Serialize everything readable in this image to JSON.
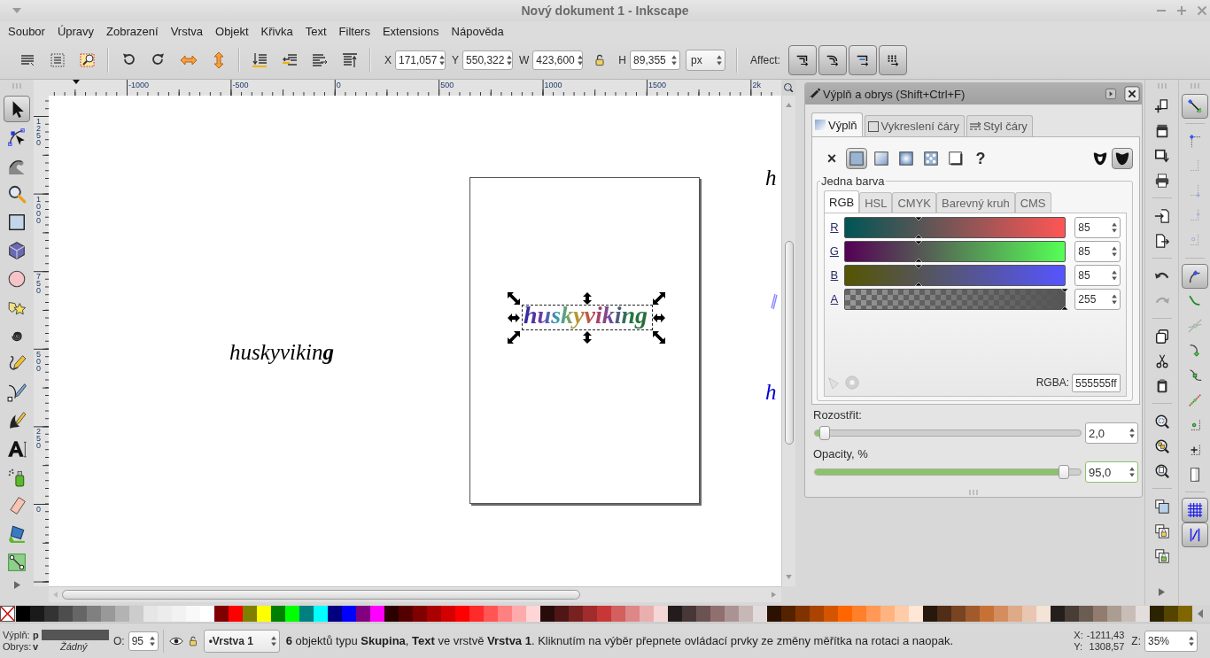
{
  "window": {
    "title": "Nový dokument 1 - Inkscape"
  },
  "menu": [
    "Soubor",
    "Úpravy",
    "Zobrazení",
    "Vrstva",
    "Objekt",
    "Křivka",
    "Text",
    "Filters",
    "Extensions",
    "Nápověda"
  ],
  "toolbar": {
    "fields": [
      {
        "label": "X",
        "value": "171,057"
      },
      {
        "label": "Y",
        "value": "550,322"
      },
      {
        "label": "W",
        "value": "423,600"
      },
      {
        "label": "H",
        "value": "89,355"
      }
    ],
    "unit": "px",
    "affect_label": "Affect:",
    "affect": [
      {
        "selected": true
      },
      {
        "selected": true
      },
      {
        "selected": true
      },
      {
        "selected": true
      }
    ]
  },
  "rulers": {
    "horizontal": [
      "-1000",
      "-500",
      "0",
      "500",
      "1000",
      "1500",
      "2k"
    ],
    "vertical": [
      "1250",
      "1000",
      "750",
      "500",
      "250",
      "0"
    ]
  },
  "tools": [
    {
      "selected": true
    },
    {
      "selected": false
    },
    {
      "selected": false
    },
    {
      "selected": false
    },
    {
      "selected": false
    },
    {
      "selected": false
    },
    {
      "selected": false
    },
    {
      "selected": false
    },
    {
      "selected": false
    },
    {
      "selected": false
    },
    {
      "selected": false
    },
    {
      "selected": false
    },
    {
      "selected": false
    },
    {
      "selected": false
    },
    {
      "selected": false
    },
    {
      "selected": false
    },
    {
      "selected": false
    }
  ],
  "canvas": {
    "loose_text": "huskyvikin**g**",
    "selected_text": "huskyviking",
    "edge_texts": [
      {
        "text": "h",
        "color": "#000000"
      },
      {
        "text": "h",
        "color": "#0000cc"
      }
    ]
  },
  "fill_stroke": {
    "title": "Výplň a obrys (Shift+Ctrl+F)",
    "tabs": [
      {
        "label": "Výplň",
        "selected": true
      },
      {
        "label": "Vykreslení čáry",
        "selected": false
      },
      {
        "label": "Styl čáry",
        "selected": false
      }
    ],
    "paint_types": [
      {
        "kind": "none",
        "label": "×",
        "selected": false
      },
      {
        "kind": "flat",
        "selected": true
      },
      {
        "kind": "linear",
        "selected": false
      },
      {
        "kind": "radial",
        "selected": false
      },
      {
        "kind": "pattern",
        "selected": false
      },
      {
        "kind": "swatch",
        "selected": false
      },
      {
        "kind": "unset",
        "label": "?",
        "selected": false
      }
    ],
    "fill_rules": [
      {
        "kind": "evenodd",
        "selected": false
      },
      {
        "kind": "nonzero",
        "selected": true
      }
    ],
    "mode_label": "Jedna barva",
    "color_tabs": [
      {
        "label": "RGB",
        "selected": true
      },
      {
        "label": "HSL",
        "selected": false
      },
      {
        "label": "CMYK",
        "selected": false
      },
      {
        "label": "Barevný kruh",
        "selected": false
      },
      {
        "label": "CMS",
        "selected": false
      }
    ],
    "channels": [
      {
        "name": "R",
        "value": "85",
        "level": 0.333
      },
      {
        "name": "G",
        "value": "85",
        "level": 0.333
      },
      {
        "name": "B",
        "value": "85",
        "level": 0.333
      },
      {
        "name": "A",
        "value": "255",
        "level": 1
      }
    ],
    "rgba_label": "RGBA:",
    "rgba": "555555ff",
    "blur": {
      "label": "Rozostřit:",
      "value": "2,0",
      "level": 0.02
    },
    "opacity": {
      "label": "Opacity, %",
      "value": "95,0",
      "level": 0.95
    }
  },
  "commands": [
    {
      "disabled": false
    },
    {
      "disabled": false
    },
    {
      "disabled": false
    },
    {
      "disabled": false
    },
    {
      "disabled": false
    },
    {
      "disabled": false
    },
    {
      "disabled": false
    },
    {
      "disabled": true
    },
    {
      "disabled": false
    },
    {
      "disabled": false
    },
    {
      "disabled": false
    },
    {
      "disabled": false
    },
    {
      "disabled": false
    },
    {
      "disabled": false
    },
    {
      "disabled": false
    },
    {
      "disabled": false
    },
    {
      "disabled": false
    }
  ],
  "snap": [
    {
      "selected": true,
      "disabled": false
    },
    {
      "selected": false,
      "disabled": false
    },
    {
      "selected": false,
      "disabled": true
    },
    {
      "selected": false,
      "disabled": true
    },
    {
      "selected": false,
      "disabled": true
    },
    {
      "selected": false,
      "disabled": true
    },
    {
      "selected": true,
      "disabled": false
    },
    {
      "selected": false,
      "disabled": false
    },
    {
      "selected": false,
      "disabled": true
    },
    {
      "selected": false,
      "disabled": false
    },
    {
      "selected": false,
      "disabled": false
    },
    {
      "selected": false,
      "disabled": false
    },
    {
      "selected": false,
      "disabled": false
    },
    {
      "selected": false,
      "disabled": false
    },
    {
      "selected": false,
      "disabled": false
    },
    {
      "selected": true,
      "disabled": false
    },
    {
      "selected": true,
      "disabled": false
    }
  ],
  "palette": {
    "swatches": [
      {
        "color": "#000000"
      },
      {
        "color": "#1a1a1a"
      },
      {
        "color": "#333333"
      },
      {
        "color": "#4d4d4d"
      },
      {
        "color": "#666666"
      },
      {
        "color": "#808080"
      },
      {
        "color": "#999999"
      },
      {
        "color": "#b3b3b3"
      },
      {
        "color": "#cccccc"
      },
      {
        "color": "#e6e6e6"
      },
      {
        "color": "#ececec"
      },
      {
        "color": "#f2f2f2"
      },
      {
        "color": "#f9f9f9"
      },
      {
        "color": "#ffffff"
      },
      {
        "color": "#800000"
      },
      {
        "color": "#ff0000"
      },
      {
        "color": "#808000"
      },
      {
        "color": "#ffff00"
      },
      {
        "color": "#008000"
      },
      {
        "color": "#00ff00"
      },
      {
        "color": "#008080"
      },
      {
        "color": "#00ffff"
      },
      {
        "color": "#000080"
      },
      {
        "color": "#0000ff"
      },
      {
        "color": "#800080"
      },
      {
        "color": "#ff00ff"
      },
      {
        "color": "#2b0000"
      },
      {
        "color": "#550000"
      },
      {
        "color": "#800000"
      },
      {
        "color": "#aa0000"
      },
      {
        "color": "#d40000"
      },
      {
        "color": "#ff0000"
      },
      {
        "color": "#ff2a2a"
      },
      {
        "color": "#ff5555"
      },
      {
        "color": "#ff8080"
      },
      {
        "color": "#ffaaaa"
      },
      {
        "color": "#ffd5d5"
      },
      {
        "color": "#280b0b"
      },
      {
        "color": "#501616"
      },
      {
        "color": "#782121"
      },
      {
        "color": "#a02c2c"
      },
      {
        "color": "#c83737"
      },
      {
        "color": "#d35f5f"
      },
      {
        "color": "#de8787"
      },
      {
        "color": "#e9afaf"
      },
      {
        "color": "#f4d7d7"
      },
      {
        "color": "#241c1c"
      },
      {
        "color": "#483737"
      },
      {
        "color": "#6c5353"
      },
      {
        "color": "#916f6f"
      },
      {
        "color": "#ac9393"
      },
      {
        "color": "#c8b7b7"
      },
      {
        "color": "#e3dbdb"
      },
      {
        "color": "#2b1100"
      },
      {
        "color": "#552200"
      },
      {
        "color": "#803300"
      },
      {
        "color": "#aa4400"
      },
      {
        "color": "#d45500"
      },
      {
        "color": "#ff6600"
      },
      {
        "color": "#ff7f2a"
      },
      {
        "color": "#ff9955"
      },
      {
        "color": "#ffb380"
      },
      {
        "color": "#ffccaa"
      },
      {
        "color": "#ffe6d5"
      },
      {
        "color": "#28170b"
      },
      {
        "color": "#502d16"
      },
      {
        "color": "#784421"
      },
      {
        "color": "#a05a2c"
      },
      {
        "color": "#c87137"
      },
      {
        "color": "#d38d5f"
      },
      {
        "color": "#deaa87"
      },
      {
        "color": "#e9c6af"
      },
      {
        "color": "#f4e3d7"
      },
      {
        "color": "#241f1c"
      },
      {
        "color": "#483e37"
      },
      {
        "color": "#6c5d53"
      },
      {
        "color": "#917c6f"
      },
      {
        "color": "#ac9d93"
      },
      {
        "color": "#c8beb7"
      },
      {
        "color": "#e3dedb"
      },
      {
        "color": "#2b2200"
      },
      {
        "color": "#554400"
      },
      {
        "color": "#806600"
      }
    ]
  },
  "status": {
    "fill_label": "Výplň:",
    "fill_value": "p",
    "stroke_label": "Obrys:",
    "stroke_value": "v",
    "stroke_none": "Žádný",
    "opacity_label": "O:",
    "opacity": "95",
    "layer": "•Vrstva 1",
    "message": "**6** objektů typu **Skupina**, **Text** ve vrstvě **Vrstva 1**. Kliknutím na výběr přepnete ovládací prvky ze změny měřítka na rotaci a naopak.",
    "coords": [
      {
        "label": "X:",
        "value": "-1211,43"
      },
      {
        "label": "Y:",
        "value": "1308,57"
      }
    ],
    "zoom_label": "Z:",
    "zoom": "35%"
  }
}
